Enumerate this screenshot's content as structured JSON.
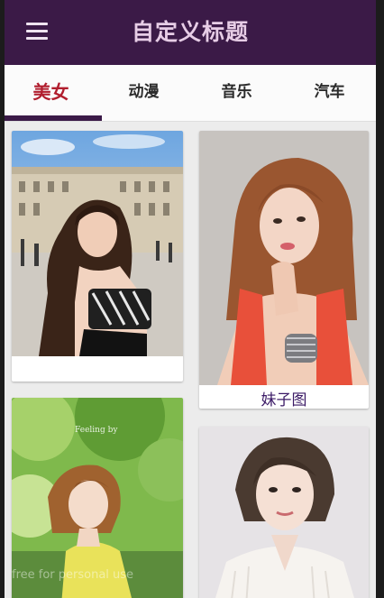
{
  "app": {
    "title": "自定义标题"
  },
  "tabs": [
    {
      "label": "美女",
      "selected": true
    },
    {
      "label": "动漫",
      "selected": false
    },
    {
      "label": "音乐",
      "selected": false
    },
    {
      "label": "汽车",
      "selected": false
    }
  ],
  "cards": [
    {
      "caption": "",
      "photo": "woman-paris-palace-photo"
    },
    {
      "caption": "妹子图",
      "photo": "woman-red-top-photo"
    },
    {
      "caption": "",
      "photo": "woman-garden-yellow-photo"
    },
    {
      "caption": "",
      "photo": "woman-white-sweater-photo"
    }
  ],
  "overlay": {
    "watermark": "free for personal use"
  },
  "colors": {
    "appbar": "#3b1a47",
    "title": "#e7cde6",
    "tab_active": "#b11e2e",
    "indicator": "#3b1a47",
    "caption": "#3b1a66"
  }
}
